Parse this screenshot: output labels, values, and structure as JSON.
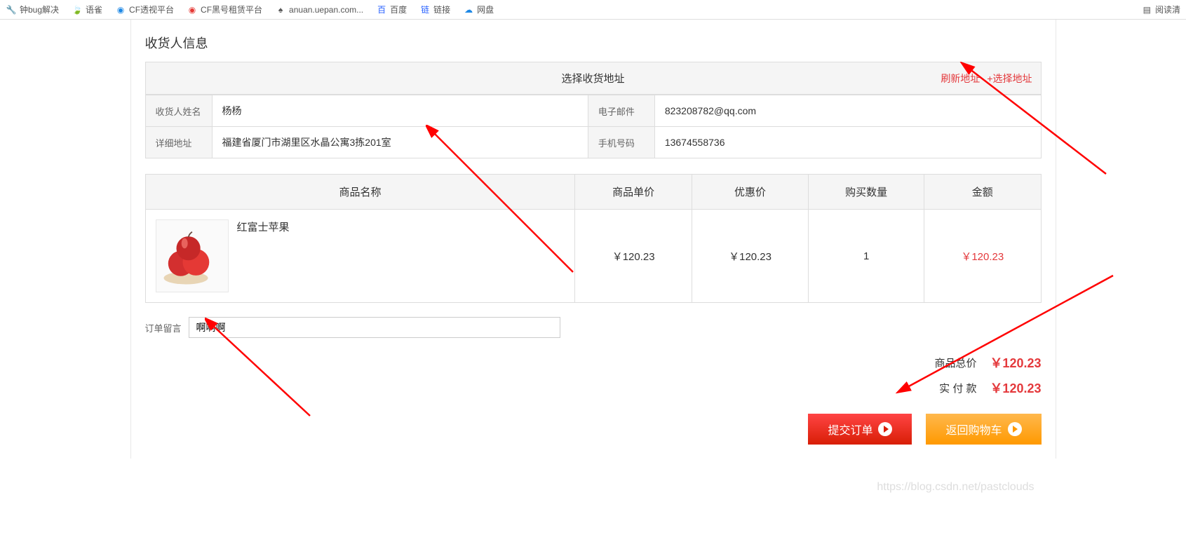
{
  "bookmarks": [
    {
      "icon": "🔧",
      "label": "钟bug解决",
      "color": "#555"
    },
    {
      "icon": "🍃",
      "label": "语雀",
      "color": "#5bb02a"
    },
    {
      "icon": "🔵",
      "label": "CF透视平台",
      "color": "#1e88e5"
    },
    {
      "icon": "🔴",
      "label": "CF黑号租赁平台",
      "color": "#e53935"
    },
    {
      "icon": "⬛",
      "label": "anuan.uepan.com...",
      "color": "#333"
    },
    {
      "icon": "🀄",
      "label": "百度",
      "color": "#2962ff"
    },
    {
      "icon": "🔗",
      "label": "链接",
      "color": "#2962ff"
    },
    {
      "icon": "☁",
      "label": "网盘",
      "color": "#1e88e5"
    }
  ],
  "bookmarks_right": "阅读清",
  "section_title": "收货人信息",
  "address_header": {
    "title": "选择收货地址",
    "refresh": "刷新地址",
    "select": "+选择地址"
  },
  "recipient": {
    "name_label": "收货人姓名",
    "name": "杨杨",
    "email_label": "电子邮件",
    "email": "823208782@qq.com",
    "address_label": "详细地址",
    "address": "福建省厦门市湖里区水晶公寓3拣201室",
    "phone_label": "手机号码",
    "phone": "13674558736"
  },
  "product_headers": {
    "name": "商品名称",
    "unit_price": "商品单价",
    "discount": "优惠价",
    "quantity": "购买数量",
    "amount": "金额"
  },
  "products": [
    {
      "name": "红富士苹果",
      "unit_price": "￥120.23",
      "discount": "￥120.23",
      "quantity": "1",
      "amount": "￥120.23"
    }
  ],
  "order_note": {
    "label": "订单留言",
    "value": "啊啊啊"
  },
  "summary": {
    "subtotal_label": "商品总价",
    "subtotal": "￥120.23",
    "total_label": "实 付 款",
    "total": "￥120.23"
  },
  "buttons": {
    "submit": "提交订单",
    "back": "返回购物车"
  },
  "watermark": "https://blog.csdn.net/pastclouds"
}
